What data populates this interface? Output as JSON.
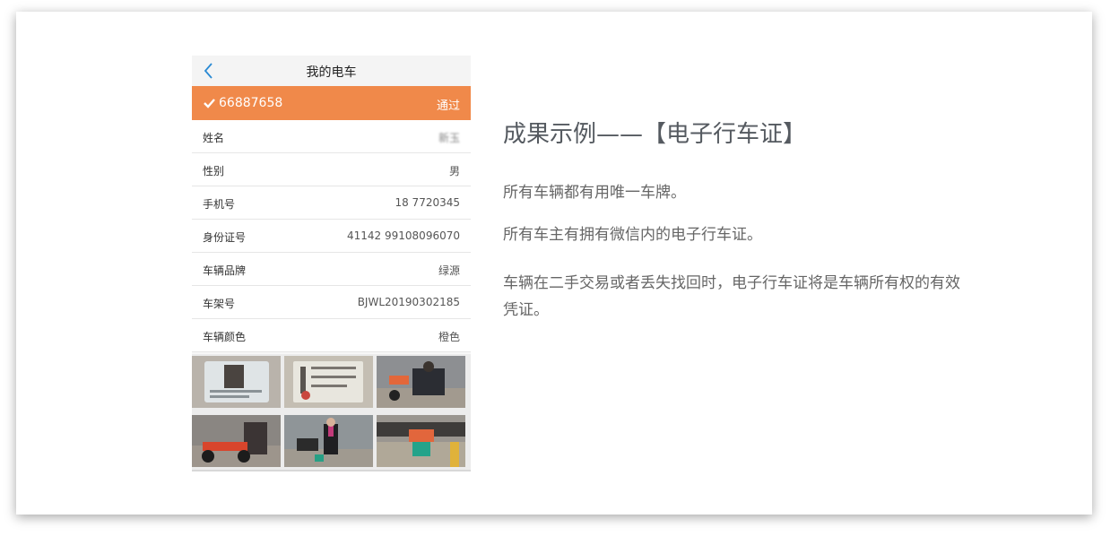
{
  "phone": {
    "nav": {
      "title": "我的电车",
      "back_icon": "chevron-left-icon"
    },
    "status": {
      "check_icon": "check-icon",
      "plate": "66887658",
      "state": "通过"
    },
    "fields": [
      {
        "label": "姓名",
        "value": "新玉"
      },
      {
        "label": "性别",
        "value": "男"
      },
      {
        "label": "手机号",
        "value": "18  7720345"
      },
      {
        "label": "身份证号",
        "value": "41142   99108096070"
      },
      {
        "label": "车辆品牌",
        "value": "绿源"
      },
      {
        "label": "车架号",
        "value": "BJWL20190302185"
      },
      {
        "label": "车辆颜色",
        "value": "橙色"
      }
    ],
    "photos": [
      "id-card-photo",
      "license-photo",
      "street-scooter-photo",
      "scooter-photo",
      "owner-with-scooter-photo",
      "scooter-rear-photo"
    ]
  },
  "slide": {
    "heading": "成果示例——【电子行车证】",
    "paragraphs": [
      "所有车辆都有用唯一车牌。",
      "所有车主有拥有微信内的电子行车证。",
      "车辆在二手交易或者丢失找回时，电子行车证将是车辆所有权的有效凭证。"
    ]
  },
  "colors": {
    "accent": "#f0894a",
    "heading": "#555a60",
    "text": "#666666"
  }
}
